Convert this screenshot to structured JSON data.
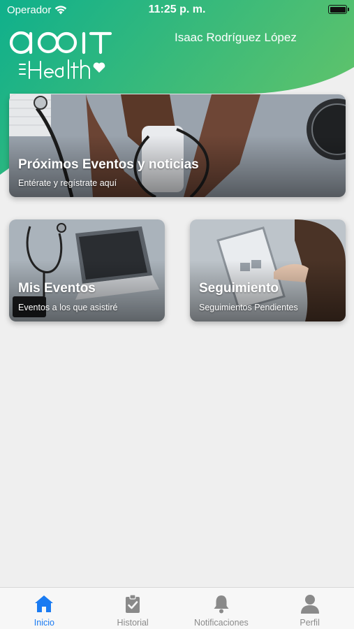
{
  "status_bar": {
    "carrier": "Operador",
    "time": "11:25 p. m."
  },
  "header": {
    "logo_text": "acoIT Health",
    "user_name": "Isaac Rodríguez López",
    "gradient_start": "#13b38a",
    "gradient_end": "#58c16e"
  },
  "cards": [
    {
      "title": "Próximos Eventos y noticias",
      "subtitle": "Entérate y regístrate aquí"
    },
    {
      "title": "Mis Eventos",
      "subtitle": "Eventos a los que asistiré"
    },
    {
      "title": "Seguimiento",
      "subtitle": "Seguimientos Pendientes"
    }
  ],
  "tabbar": {
    "active_color": "#1a7bf2",
    "inactive_color": "#8a8a8a",
    "items": [
      {
        "label": "Inicio",
        "icon": "home-icon",
        "active": true
      },
      {
        "label": "Historial",
        "icon": "clipboard-check-icon",
        "active": false
      },
      {
        "label": "Notificaciones",
        "icon": "bell-icon",
        "active": false
      },
      {
        "label": "Perfil",
        "icon": "person-icon",
        "active": false
      }
    ]
  }
}
